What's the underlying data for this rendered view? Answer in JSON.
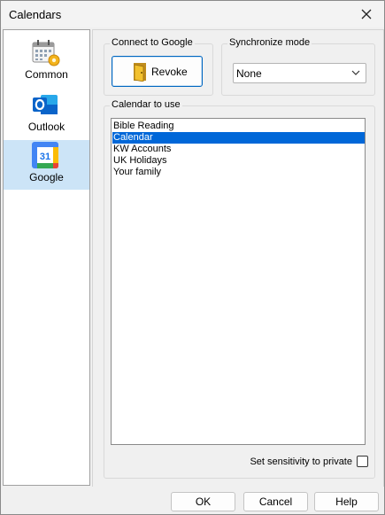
{
  "window": {
    "title": "Calendars"
  },
  "sidebar": {
    "items": [
      {
        "label": "Common",
        "icon": "calendar-settings-icon"
      },
      {
        "label": "Outlook",
        "icon": "outlook-icon"
      },
      {
        "label": "Google",
        "icon": "google-calendar-icon",
        "icon_text": "31"
      }
    ]
  },
  "connect": {
    "group_label": "Connect to Google",
    "button_label": "Revoke"
  },
  "sync": {
    "group_label": "Synchronize mode",
    "selected": "None"
  },
  "calendars": {
    "group_label": "Calendar to use",
    "items": [
      "Bible Reading",
      "Calendar",
      "KW Accounts",
      "UK Holidays",
      "Your family"
    ],
    "selected_index": 1
  },
  "sensitivity": {
    "label": "Set sensitivity to private",
    "checked": false
  },
  "footer": {
    "ok": "OK",
    "cancel": "Cancel",
    "help": "Help"
  },
  "colors": {
    "accent": "#0067c0",
    "selection": "#0067d8",
    "outlook_blue": "#0a64c9"
  }
}
